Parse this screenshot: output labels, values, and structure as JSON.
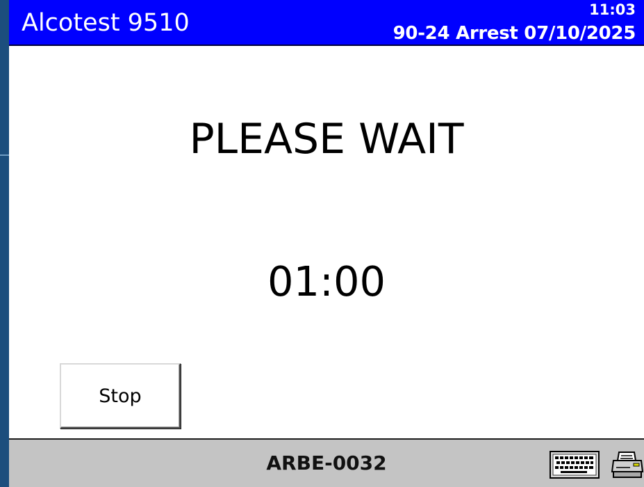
{
  "title_bar": {
    "app_title": "Alcotest 9510",
    "clock": "11:03",
    "record_info": "90-24 Arrest 07/10/2025",
    "background_color": "#0000ff",
    "text_color": "#ffffff"
  },
  "main": {
    "message": "PLEASE WAIT",
    "countdown": "01:00"
  },
  "buttons": {
    "stop_label": "Stop"
  },
  "status_bar": {
    "device_id": "ARBE-0032",
    "background_color": "#c4c4c4",
    "icons": [
      "keyboard-icon",
      "printer-icon"
    ]
  }
}
